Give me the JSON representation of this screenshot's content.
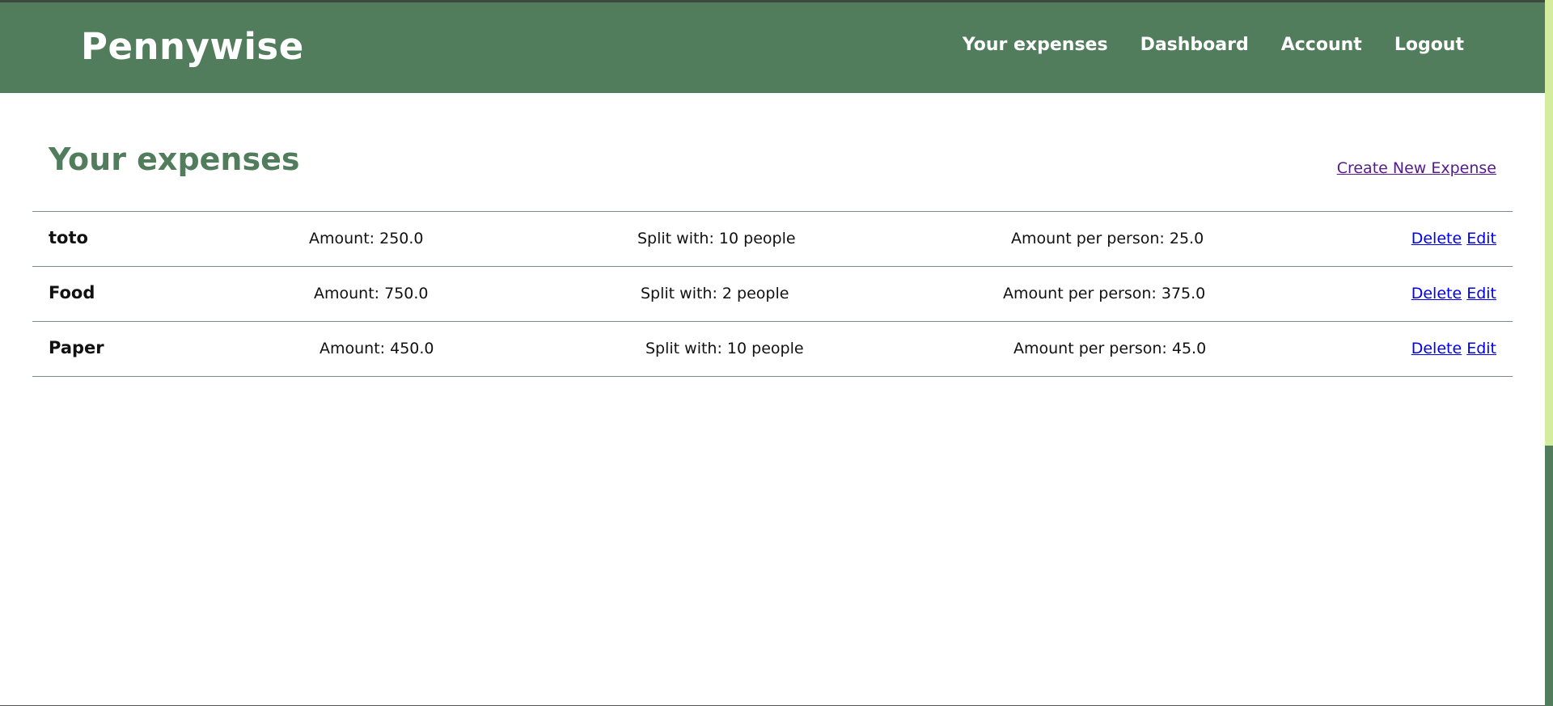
{
  "nav": {
    "brand": "Pennywise",
    "links": [
      "Your expenses",
      "Dashboard",
      "Account",
      "Logout"
    ]
  },
  "page": {
    "title": "Your expenses",
    "create_link": "Create New Expense"
  },
  "expenses": [
    {
      "name": "toto",
      "amount": "Amount: 250.0",
      "split": "Split with: 10 people",
      "per_person": "Amount per person: 25.0",
      "delete": "Delete",
      "edit": "Edit"
    },
    {
      "name": "Food",
      "amount": "Amount: 750.0",
      "split": "Split with: 2 people",
      "per_person": "Amount per person: 375.0",
      "delete": "Delete",
      "edit": "Edit"
    },
    {
      "name": "Paper",
      "amount": "Amount: 450.0",
      "split": "Split with: 10 people",
      "per_person": "Amount per person: 45.0",
      "delete": "Delete",
      "edit": "Edit"
    }
  ],
  "colors": {
    "brand_green": "#527d5d",
    "scroll_track": "#d4ec9e",
    "link_blue": "#0000ee",
    "visited_purple": "#551a8b"
  }
}
